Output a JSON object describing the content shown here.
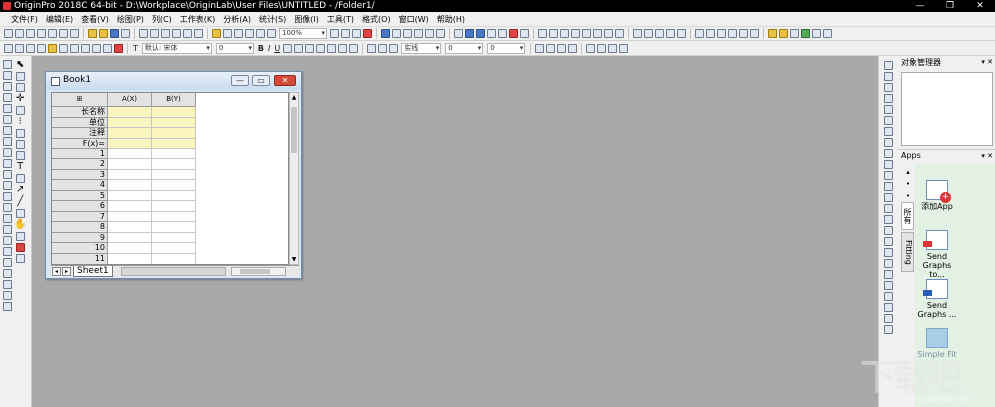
{
  "app": {
    "title": "OriginPro 2018C 64-bit - D:\\Workplace\\OriginLab\\User Files\\UNTITLED - /Folder1/",
    "window_controls": [
      "—",
      "❐",
      "✕"
    ]
  },
  "menu": [
    "文件(F)",
    "编辑(E)",
    "查看(V)",
    "绘图(P)",
    "列(C)",
    "工作表(K)",
    "分析(A)",
    "统计(S)",
    "图像(I)",
    "工具(T)",
    "格式(O)",
    "窗口(W)",
    "帮助(H)"
  ],
  "toolbar1": {
    "zoom": "100%"
  },
  "toolbar2": {
    "font": "默认: 宋体",
    "font_size": "0",
    "line_style": "实线",
    "line_width_1": "0",
    "line_width_2": "0",
    "text_tool": "T",
    "bold": "B",
    "italic": "I",
    "underline": "U"
  },
  "book": {
    "title": "Book1",
    "columns": [
      "A(X)",
      "B(Y)"
    ],
    "meta_rows": [
      "长名称",
      "单位",
      "注释",
      "F(x)="
    ],
    "rows": [
      "1",
      "2",
      "3",
      "4",
      "5",
      "6",
      "7",
      "8",
      "9",
      "10",
      "11"
    ],
    "sheet_tab": "Sheet1",
    "sheet_nav": [
      "◂",
      "▸"
    ],
    "scroll_up": "▲",
    "scroll_down": "▼"
  },
  "object_manager": {
    "title": "对象管理器",
    "controls": "▾ ✕"
  },
  "apps_panel": {
    "title": "Apps",
    "controls": "▾ ✕",
    "dots": "▴ • • • ▾",
    "tabs": [
      "所有",
      "Fitting"
    ],
    "items": [
      {
        "label": "添加App",
        "icon": "add-app-icon",
        "enabled": true
      },
      {
        "label": "Send Graphs to...",
        "icon": "send-graphs-ppt-icon",
        "enabled": true
      },
      {
        "label": "Send Graphs ...",
        "icon": "send-graphs-word-icon",
        "enabled": true
      },
      {
        "label": "Simple Fit",
        "icon": "simple-fit-icon",
        "enabled": false
      }
    ]
  },
  "watermark": {
    "text": "下载吧",
    "url": "www.xiazaiba.com"
  },
  "colors": {
    "workspace": "#a9a9a9",
    "meta_cells": "#fbf6c0",
    "apps_bg": "#e3f1e4",
    "close_button": "#d44a3a"
  }
}
